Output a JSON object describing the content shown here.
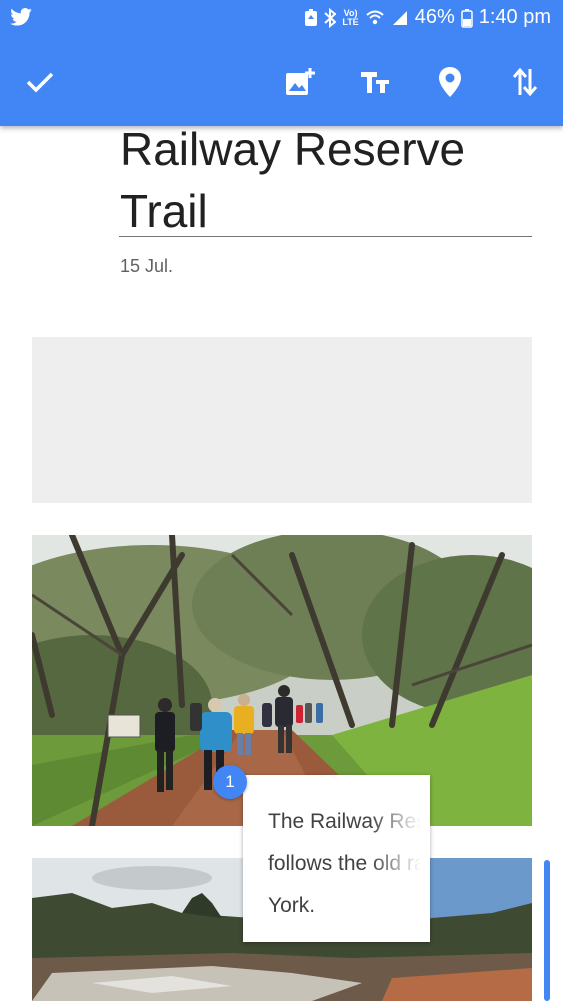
{
  "status_bar": {
    "time": "1:40 pm",
    "battery": "46%",
    "network_label_top": "Vo)",
    "network_label_bottom": "LTE",
    "icons": [
      "twitter-icon",
      "battery-saver-icon",
      "bluetooth-icon",
      "volte-icon",
      "wifi-icon",
      "signal-icon",
      "battery-icon"
    ]
  },
  "toolbar": {
    "done_icon": "check-icon",
    "actions": [
      "add-photo-icon",
      "text-format-icon",
      "location-icon",
      "reorder-icon"
    ]
  },
  "story": {
    "title": "Railway Reserve Trail",
    "date": "15 Jul."
  },
  "media": {
    "badge_number": "1",
    "caption": "The Railway Reserve Trail\nfollows the old railway line to\nYork."
  },
  "colors": {
    "accent": "#4285f4",
    "placeholder": "#eeeeee",
    "text": "#212121"
  }
}
